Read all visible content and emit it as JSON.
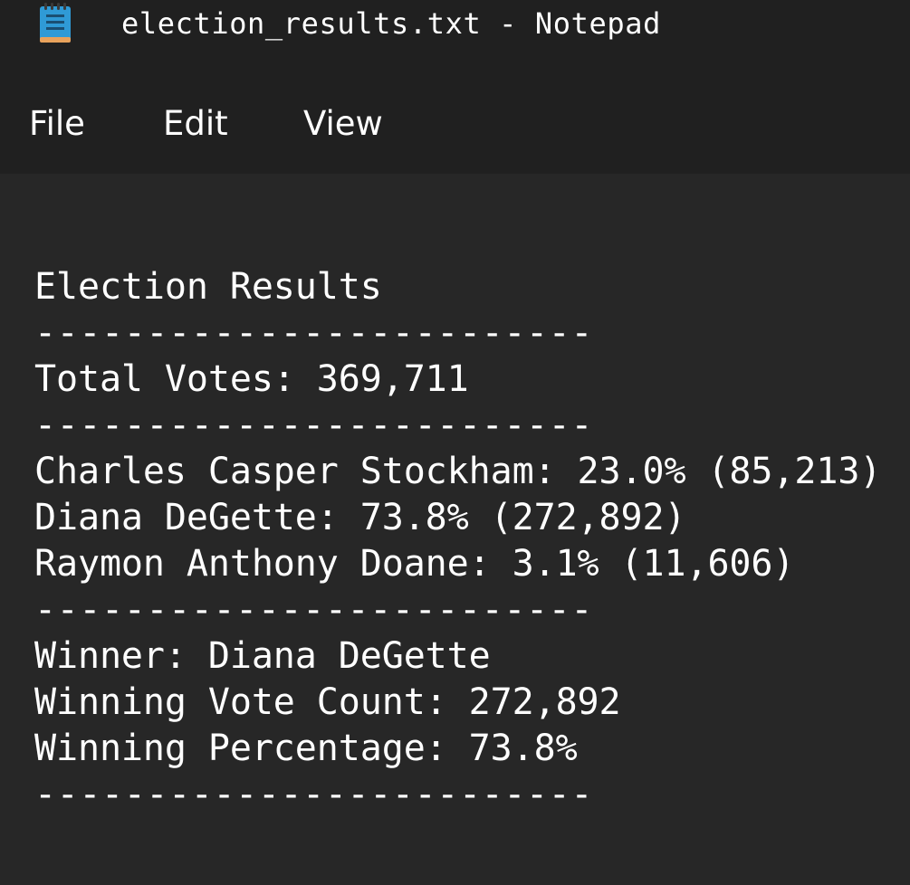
{
  "window": {
    "title": "election_results.txt - Notepad",
    "icon": "notepad-icon",
    "background": "#272727",
    "chrome": "#202020"
  },
  "menu": {
    "items": [
      "File",
      "Edit",
      "View"
    ]
  },
  "document": {
    "lines": [
      "Election Results",
      "-------------------------",
      "Total Votes: 369,711",
      "-------------------------",
      "Charles Casper Stockham: 23.0% (85,213)",
      "Diana DeGette: 73.8% (272,892)",
      "Raymon Anthony Doane: 3.1% (11,606)",
      "-------------------------",
      "Winner: Diana DeGette",
      "Winning Vote Count: 272,892",
      "Winning Percentage: 73.8%",
      "-------------------------"
    ]
  }
}
